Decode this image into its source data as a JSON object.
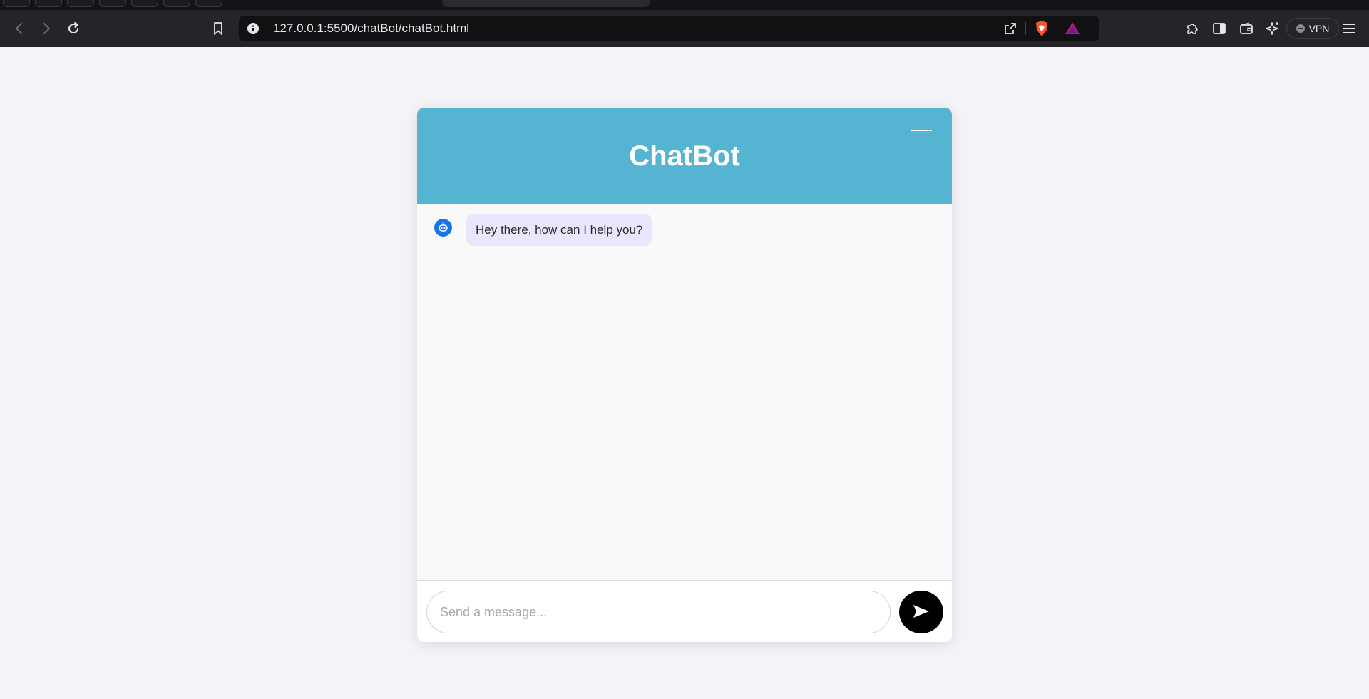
{
  "browser": {
    "url": "127.0.0.1:5500/chatBot/chatBot.html",
    "vpn_label": "VPN",
    "tabs": [
      "tab-1",
      "tab-2",
      "tab-3",
      "tab-4",
      "tab-5",
      "tab-6",
      "tab-7"
    ],
    "colors": {
      "toolbar": "#252529",
      "urlbar": "#111113",
      "tabstrip": "#141416"
    }
  },
  "chatbot": {
    "title": "ChatBot",
    "messages": [
      {
        "sender": "bot",
        "icon": "bot-icon",
        "text": "Hey there, how can I help you?"
      }
    ],
    "input_placeholder": "Send a message...",
    "input_value": "",
    "send_icon": "send-icon",
    "minimize_icon": "minimize-icon",
    "colors": {
      "header": "#54b4d2",
      "bubble": "#e9e7fd",
      "avatar": "#1a73e8",
      "send_button": "#000000",
      "page_background": "#f3f3f8"
    }
  }
}
